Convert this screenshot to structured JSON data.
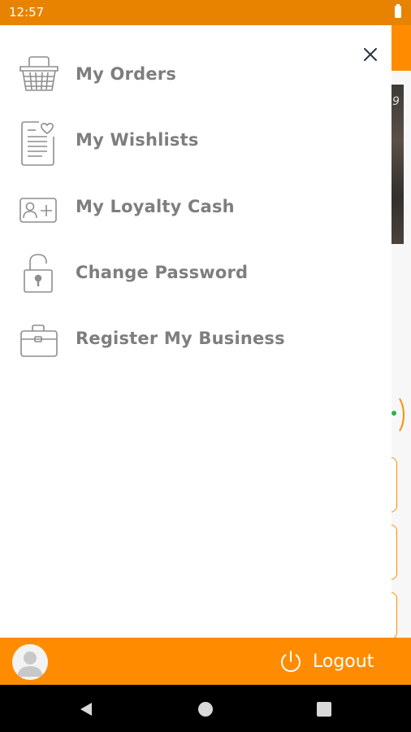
{
  "status_bar": {
    "time": "12:57",
    "battery_icon": "battery-full-icon"
  },
  "background_app": {
    "image_text": "9"
  },
  "drawer": {
    "close_icon": "close-icon",
    "menu_items": [
      {
        "label": "My Orders",
        "icon": "basket-icon"
      },
      {
        "label": "My Wishlists",
        "icon": "wishlist-icon"
      },
      {
        "label": "My Loyalty Cash",
        "icon": "loyalty-card-icon"
      },
      {
        "label": "Change Password",
        "icon": "unlock-icon"
      },
      {
        "label": "Register My Business",
        "icon": "briefcase-icon"
      }
    ]
  },
  "footer": {
    "avatar_icon": "user-avatar-icon",
    "logout_label": "Logout",
    "logout_icon": "power-icon"
  },
  "nav_bar": {
    "back": "back-icon",
    "home": "home-icon",
    "recent": "recent-apps-icon"
  },
  "colors": {
    "accent": "#ff8c00",
    "status_bar": "#e88300",
    "label": "#7e7e7e"
  }
}
